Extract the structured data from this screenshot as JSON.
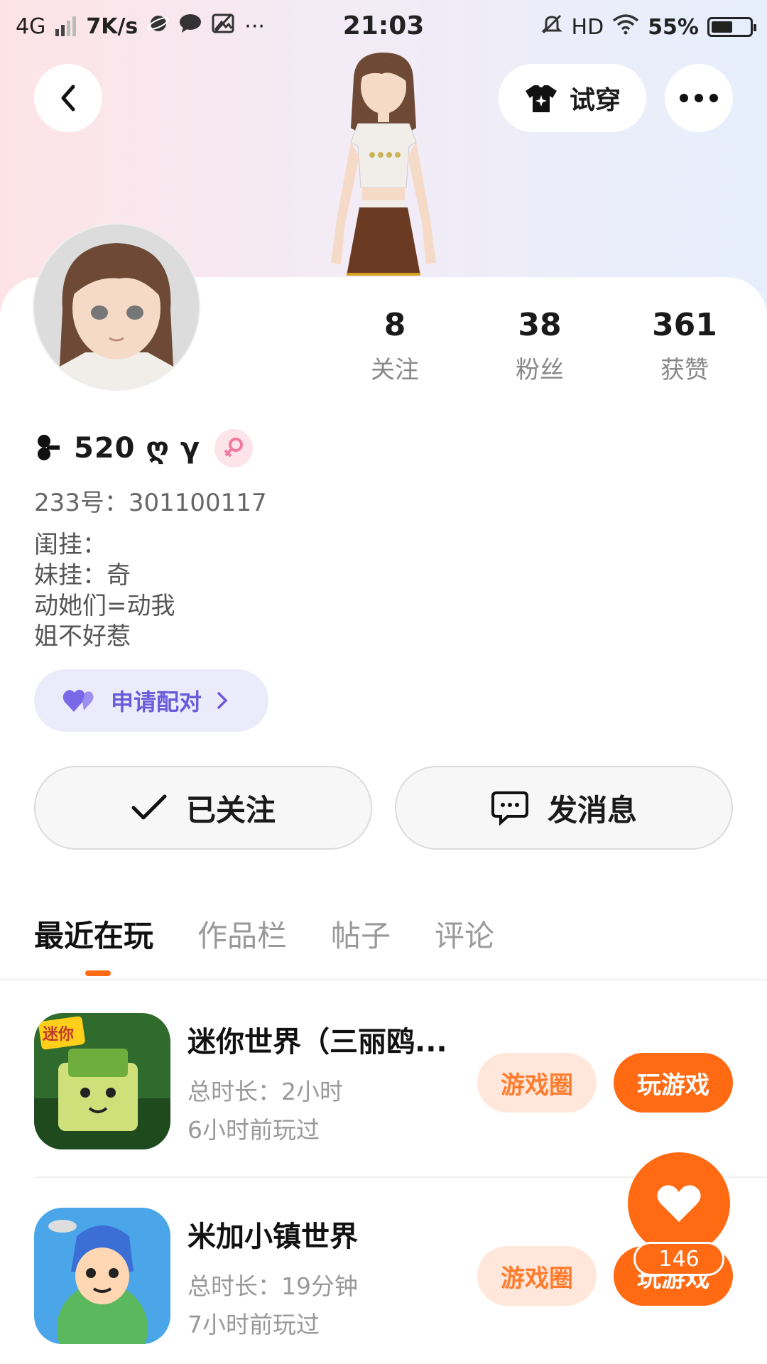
{
  "status_bar": {
    "network": "4G",
    "speed": "7K/s",
    "more": "···",
    "time": "21:03",
    "hd": "HD",
    "battery": "55%",
    "battery_level": 0.55
  },
  "header": {
    "try_on_label": "试穿"
  },
  "profile": {
    "nickname": "520 ღ γ",
    "stats": [
      {
        "value": "8",
        "label": "关注"
      },
      {
        "value": "38",
        "label": "粉丝"
      },
      {
        "value": "361",
        "label": "获赞"
      }
    ],
    "id_line": "233号：301100117",
    "bio": [
      "闺挂：",
      "妹挂：奇",
      "动她们=动我",
      "姐不好惹"
    ],
    "pair_label": "申请配对",
    "follow_label": "已关注",
    "message_label": "发消息"
  },
  "tabs": [
    {
      "label": "最近在玩",
      "active": true
    },
    {
      "label": "作品栏",
      "active": false
    },
    {
      "label": "帖子",
      "active": false
    },
    {
      "label": "评论",
      "active": false
    }
  ],
  "games": [
    {
      "name": "迷你世界（三丽鸥...",
      "duration": "总时长：2小时",
      "last_played": "6小时前玩过",
      "circle_label": "游戏圈",
      "play_label": "玩游戏",
      "icon_badge": "迷你"
    },
    {
      "name": "米加小镇世界",
      "duration": "总时长：19分钟",
      "last_played": "7小时前玩过",
      "circle_label": "游戏圈",
      "play_label": "玩游戏"
    }
  ],
  "fab": {
    "count": "146"
  },
  "colors": {
    "accent": "#ff6a13",
    "pair_purple": "#6a5bd8",
    "pill_bg": "#ffe8db"
  }
}
